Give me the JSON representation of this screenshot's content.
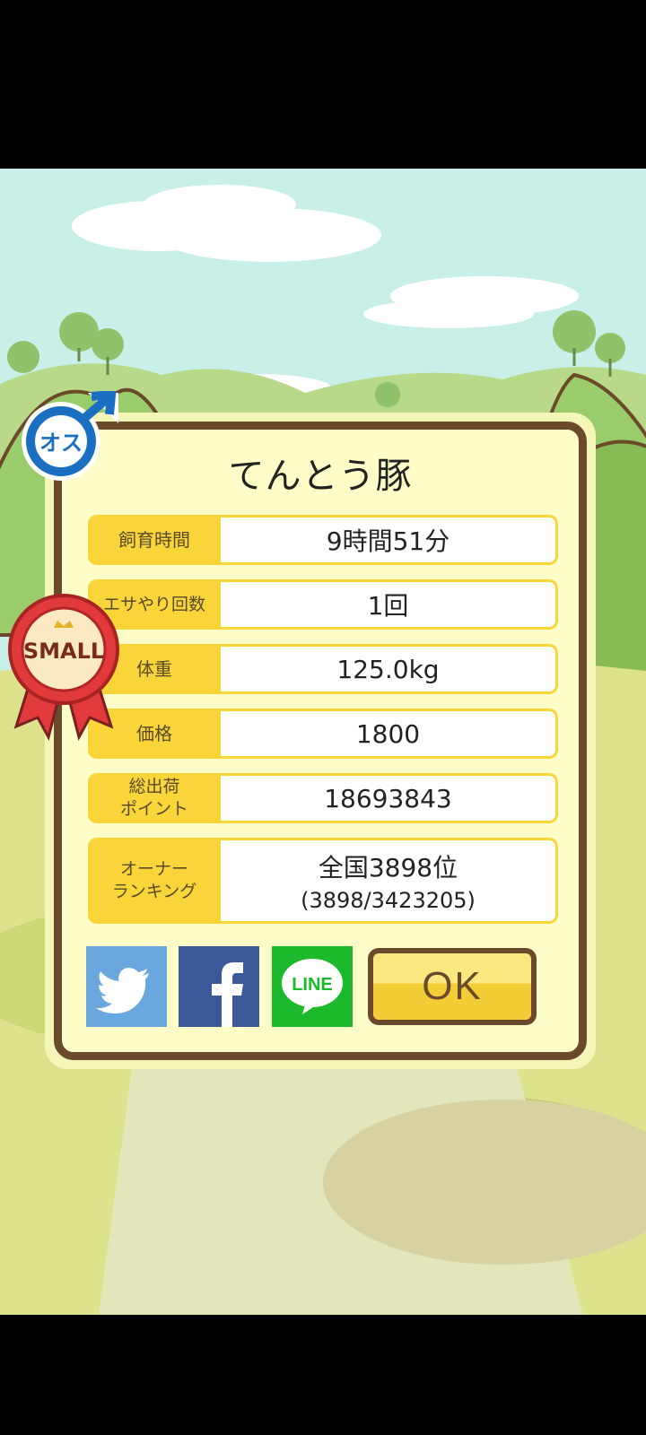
{
  "title": "てんとう豚",
  "gender_badge": {
    "text": "オス",
    "icon": "male-symbol-icon",
    "color": "#1b6fc2"
  },
  "size_badge": {
    "text": "SMALL",
    "icon": "ribbon-icon",
    "color": "#e23a3a"
  },
  "rows": [
    {
      "label": "飼育時間",
      "value": "9時間51分"
    },
    {
      "label": "エサやり回数",
      "value": "1回"
    },
    {
      "label": "体重",
      "value": "125.0kg"
    },
    {
      "label": "価格",
      "value": "1800"
    },
    {
      "label": "総出荷\nポイント",
      "value": "18693843"
    },
    {
      "label": "オーナー\nランキング",
      "value": "全国3898位",
      "sub": "(3898/3423205)"
    }
  ],
  "buttons": {
    "twitter": {
      "icon": "twitter-bird-icon"
    },
    "facebook": {
      "icon": "facebook-f-icon"
    },
    "line": {
      "label": "LINE",
      "icon": "line-chat-icon"
    },
    "ok": "OK"
  }
}
